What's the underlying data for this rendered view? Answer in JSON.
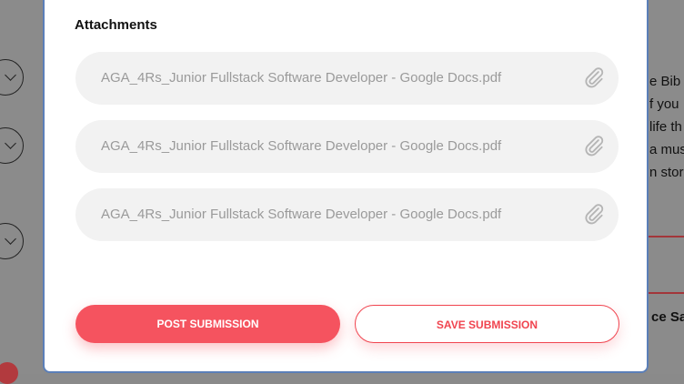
{
  "modal": {
    "section_title": "Attachments",
    "attachments": [
      {
        "filename": "AGA_4Rs_Junior Fullstack Software Developer - Google Docs.pdf",
        "icon": "paperclip-icon"
      },
      {
        "filename": "AGA_4Rs_Junior Fullstack Software Developer - Google Docs.pdf",
        "icon": "paperclip-icon"
      },
      {
        "filename": "AGA_4Rs_Junior Fullstack Software Developer - Google Docs.pdf",
        "icon": "paperclip-icon"
      }
    ],
    "post_label": "POST SUBMISSION",
    "save_label": "SAVE SUBMISSION"
  },
  "background": {
    "text_lines": [
      "e Bib",
      "f you",
      "life th",
      "a mus",
      "n stor"
    ],
    "heading_fragment": "ce Sa"
  },
  "colors": {
    "accent": "#f5535f",
    "modal_border": "#5b7fb8",
    "attachment_bg": "#f2f2f2"
  }
}
